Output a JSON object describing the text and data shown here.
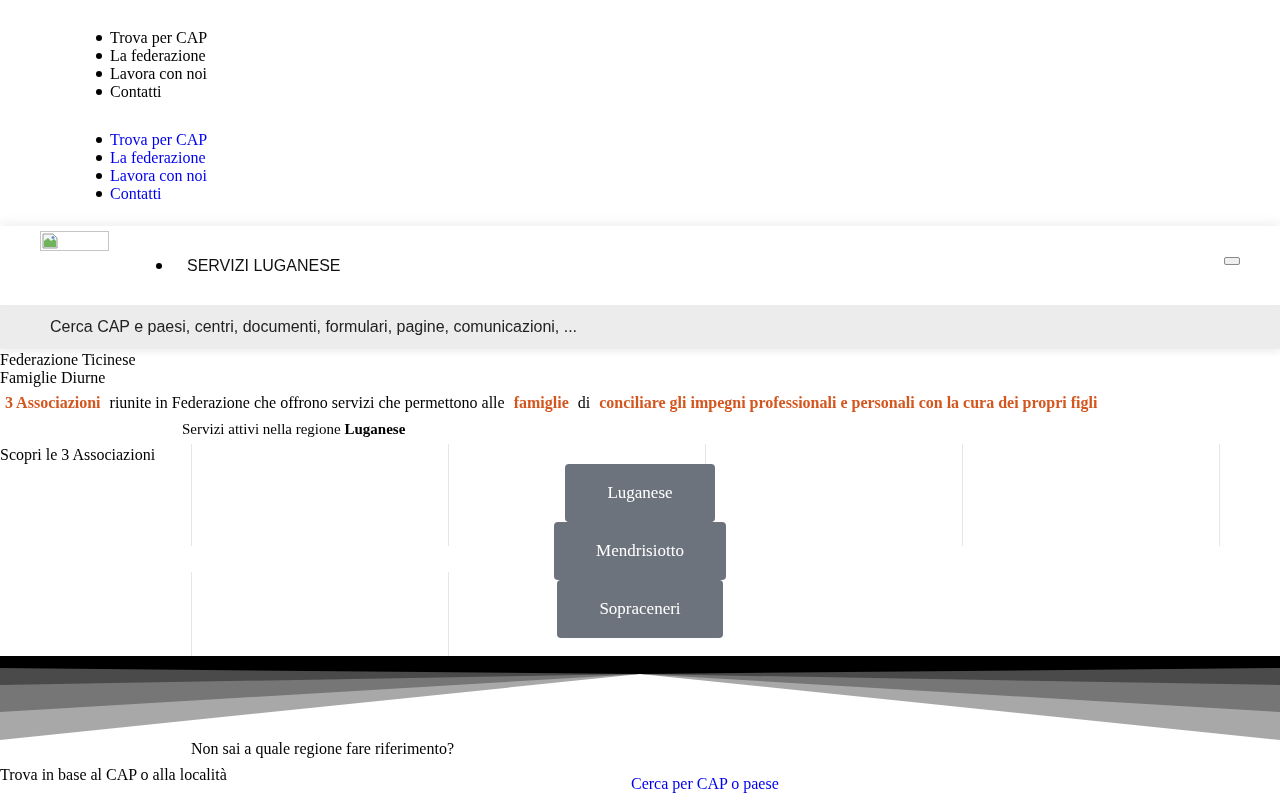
{
  "top_menu": {
    "items": [
      "Trova per CAP",
      "La federazione",
      "Lavora con noi",
      "Contatti"
    ]
  },
  "link_menu": {
    "items": [
      "Trova per CAP",
      "La federazione",
      "Lavora con noi",
      "Contatti"
    ]
  },
  "header": {
    "nav_items": [
      "SERVIZI LUGANESE"
    ],
    "search": {
      "placeholder": "Cerca CAP e paesi, centri, documenti, formulari, pagine, comunicazioni, ..."
    }
  },
  "site_title": "Federazione Ticinese Famiglie Diurne",
  "intro": "**3 Associazioni** riunite in Federazione che offrono servizi che permettono alle **famiglie** di **conciliare gli impegni professionali e personali con la cura dei propri figli**",
  "region_note": "Servizi attivi nella regione **Luganese**",
  "associations": {
    "title": "Scopri le 3 Associazioni",
    "regions": [
      "Luganese",
      "Mendrisiotto",
      "Sopraceneri"
    ]
  },
  "finder": {
    "question": "Non sai a quale regione fare riferimento?",
    "hint": "Trova in base al CAP o alla località",
    "link": "Cerca per CAP o paese"
  }
}
